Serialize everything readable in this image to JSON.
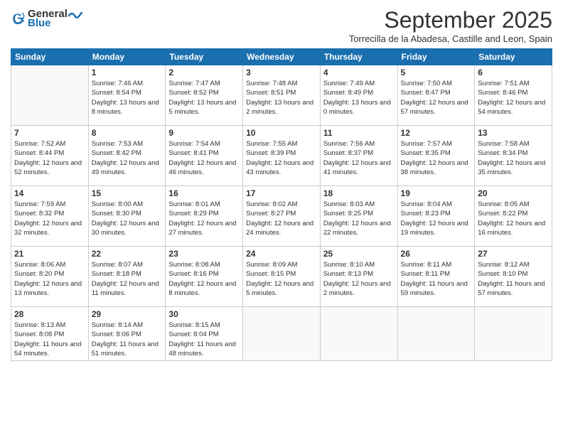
{
  "logo": {
    "general": "General",
    "blue": "Blue"
  },
  "title": "September 2025",
  "location": "Torrecilla de la Abadesa, Castille and Leon, Spain",
  "weekdays": [
    "Sunday",
    "Monday",
    "Tuesday",
    "Wednesday",
    "Thursday",
    "Friday",
    "Saturday"
  ],
  "weeks": [
    [
      {
        "day": "",
        "sunrise": "",
        "sunset": "",
        "daylight": ""
      },
      {
        "day": "1",
        "sunrise": "Sunrise: 7:46 AM",
        "sunset": "Sunset: 8:54 PM",
        "daylight": "Daylight: 13 hours and 8 minutes."
      },
      {
        "day": "2",
        "sunrise": "Sunrise: 7:47 AM",
        "sunset": "Sunset: 8:52 PM",
        "daylight": "Daylight: 13 hours and 5 minutes."
      },
      {
        "day": "3",
        "sunrise": "Sunrise: 7:48 AM",
        "sunset": "Sunset: 8:51 PM",
        "daylight": "Daylight: 13 hours and 2 minutes."
      },
      {
        "day": "4",
        "sunrise": "Sunrise: 7:49 AM",
        "sunset": "Sunset: 8:49 PM",
        "daylight": "Daylight: 13 hours and 0 minutes."
      },
      {
        "day": "5",
        "sunrise": "Sunrise: 7:50 AM",
        "sunset": "Sunset: 8:47 PM",
        "daylight": "Daylight: 12 hours and 57 minutes."
      },
      {
        "day": "6",
        "sunrise": "Sunrise: 7:51 AM",
        "sunset": "Sunset: 8:46 PM",
        "daylight": "Daylight: 12 hours and 54 minutes."
      }
    ],
    [
      {
        "day": "7",
        "sunrise": "Sunrise: 7:52 AM",
        "sunset": "Sunset: 8:44 PM",
        "daylight": "Daylight: 12 hours and 52 minutes."
      },
      {
        "day": "8",
        "sunrise": "Sunrise: 7:53 AM",
        "sunset": "Sunset: 8:42 PM",
        "daylight": "Daylight: 12 hours and 49 minutes."
      },
      {
        "day": "9",
        "sunrise": "Sunrise: 7:54 AM",
        "sunset": "Sunset: 8:41 PM",
        "daylight": "Daylight: 12 hours and 46 minutes."
      },
      {
        "day": "10",
        "sunrise": "Sunrise: 7:55 AM",
        "sunset": "Sunset: 8:39 PM",
        "daylight": "Daylight: 12 hours and 43 minutes."
      },
      {
        "day": "11",
        "sunrise": "Sunrise: 7:56 AM",
        "sunset": "Sunset: 8:37 PM",
        "daylight": "Daylight: 12 hours and 41 minutes."
      },
      {
        "day": "12",
        "sunrise": "Sunrise: 7:57 AM",
        "sunset": "Sunset: 8:35 PM",
        "daylight": "Daylight: 12 hours and 38 minutes."
      },
      {
        "day": "13",
        "sunrise": "Sunrise: 7:58 AM",
        "sunset": "Sunset: 8:34 PM",
        "daylight": "Daylight: 12 hours and 35 minutes."
      }
    ],
    [
      {
        "day": "14",
        "sunrise": "Sunrise: 7:59 AM",
        "sunset": "Sunset: 8:32 PM",
        "daylight": "Daylight: 12 hours and 32 minutes."
      },
      {
        "day": "15",
        "sunrise": "Sunrise: 8:00 AM",
        "sunset": "Sunset: 8:30 PM",
        "daylight": "Daylight: 12 hours and 30 minutes."
      },
      {
        "day": "16",
        "sunrise": "Sunrise: 8:01 AM",
        "sunset": "Sunset: 8:29 PM",
        "daylight": "Daylight: 12 hours and 27 minutes."
      },
      {
        "day": "17",
        "sunrise": "Sunrise: 8:02 AM",
        "sunset": "Sunset: 8:27 PM",
        "daylight": "Daylight: 12 hours and 24 minutes."
      },
      {
        "day": "18",
        "sunrise": "Sunrise: 8:03 AM",
        "sunset": "Sunset: 8:25 PM",
        "daylight": "Daylight: 12 hours and 22 minutes."
      },
      {
        "day": "19",
        "sunrise": "Sunrise: 8:04 AM",
        "sunset": "Sunset: 8:23 PM",
        "daylight": "Daylight: 12 hours and 19 minutes."
      },
      {
        "day": "20",
        "sunrise": "Sunrise: 8:05 AM",
        "sunset": "Sunset: 8:22 PM",
        "daylight": "Daylight: 12 hours and 16 minutes."
      }
    ],
    [
      {
        "day": "21",
        "sunrise": "Sunrise: 8:06 AM",
        "sunset": "Sunset: 8:20 PM",
        "daylight": "Daylight: 12 hours and 13 minutes."
      },
      {
        "day": "22",
        "sunrise": "Sunrise: 8:07 AM",
        "sunset": "Sunset: 8:18 PM",
        "daylight": "Daylight: 12 hours and 11 minutes."
      },
      {
        "day": "23",
        "sunrise": "Sunrise: 8:08 AM",
        "sunset": "Sunset: 8:16 PM",
        "daylight": "Daylight: 12 hours and 8 minutes."
      },
      {
        "day": "24",
        "sunrise": "Sunrise: 8:09 AM",
        "sunset": "Sunset: 8:15 PM",
        "daylight": "Daylight: 12 hours and 5 minutes."
      },
      {
        "day": "25",
        "sunrise": "Sunrise: 8:10 AM",
        "sunset": "Sunset: 8:13 PM",
        "daylight": "Daylight: 12 hours and 2 minutes."
      },
      {
        "day": "26",
        "sunrise": "Sunrise: 8:11 AM",
        "sunset": "Sunset: 8:11 PM",
        "daylight": "Daylight: 11 hours and 59 minutes."
      },
      {
        "day": "27",
        "sunrise": "Sunrise: 8:12 AM",
        "sunset": "Sunset: 8:10 PM",
        "daylight": "Daylight: 11 hours and 57 minutes."
      }
    ],
    [
      {
        "day": "28",
        "sunrise": "Sunrise: 8:13 AM",
        "sunset": "Sunset: 8:08 PM",
        "daylight": "Daylight: 11 hours and 54 minutes."
      },
      {
        "day": "29",
        "sunrise": "Sunrise: 8:14 AM",
        "sunset": "Sunset: 8:06 PM",
        "daylight": "Daylight: 11 hours and 51 minutes."
      },
      {
        "day": "30",
        "sunrise": "Sunrise: 8:15 AM",
        "sunset": "Sunset: 8:04 PM",
        "daylight": "Daylight: 11 hours and 48 minutes."
      },
      {
        "day": "",
        "sunrise": "",
        "sunset": "",
        "daylight": ""
      },
      {
        "day": "",
        "sunrise": "",
        "sunset": "",
        "daylight": ""
      },
      {
        "day": "",
        "sunrise": "",
        "sunset": "",
        "daylight": ""
      },
      {
        "day": "",
        "sunrise": "",
        "sunset": "",
        "daylight": ""
      }
    ]
  ]
}
